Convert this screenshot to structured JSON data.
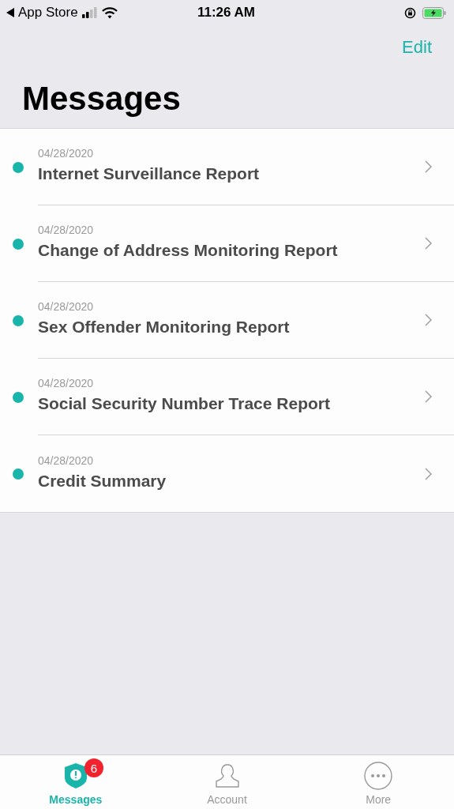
{
  "status_bar": {
    "back_label": "App Store",
    "time": "11:26 AM"
  },
  "nav": {
    "edit": "Edit"
  },
  "title": "Messages",
  "messages": [
    {
      "date": "04/28/2020",
      "title": "Internet Surveillance Report",
      "unread": true
    },
    {
      "date": "04/28/2020",
      "title": "Change of Address Monitoring Report",
      "unread": true
    },
    {
      "date": "04/28/2020",
      "title": "Sex Offender Monitoring Report",
      "unread": true
    },
    {
      "date": "04/28/2020",
      "title": "Social Security Number Trace Report",
      "unread": true
    },
    {
      "date": "04/28/2020",
      "title": "Credit Summary",
      "unread": true
    }
  ],
  "tabs": [
    {
      "kind": "messages",
      "label": "Messages",
      "selected": true,
      "badge": "6"
    },
    {
      "kind": "account",
      "label": "Account",
      "selected": false
    },
    {
      "kind": "more",
      "label": "More",
      "selected": false
    }
  ]
}
